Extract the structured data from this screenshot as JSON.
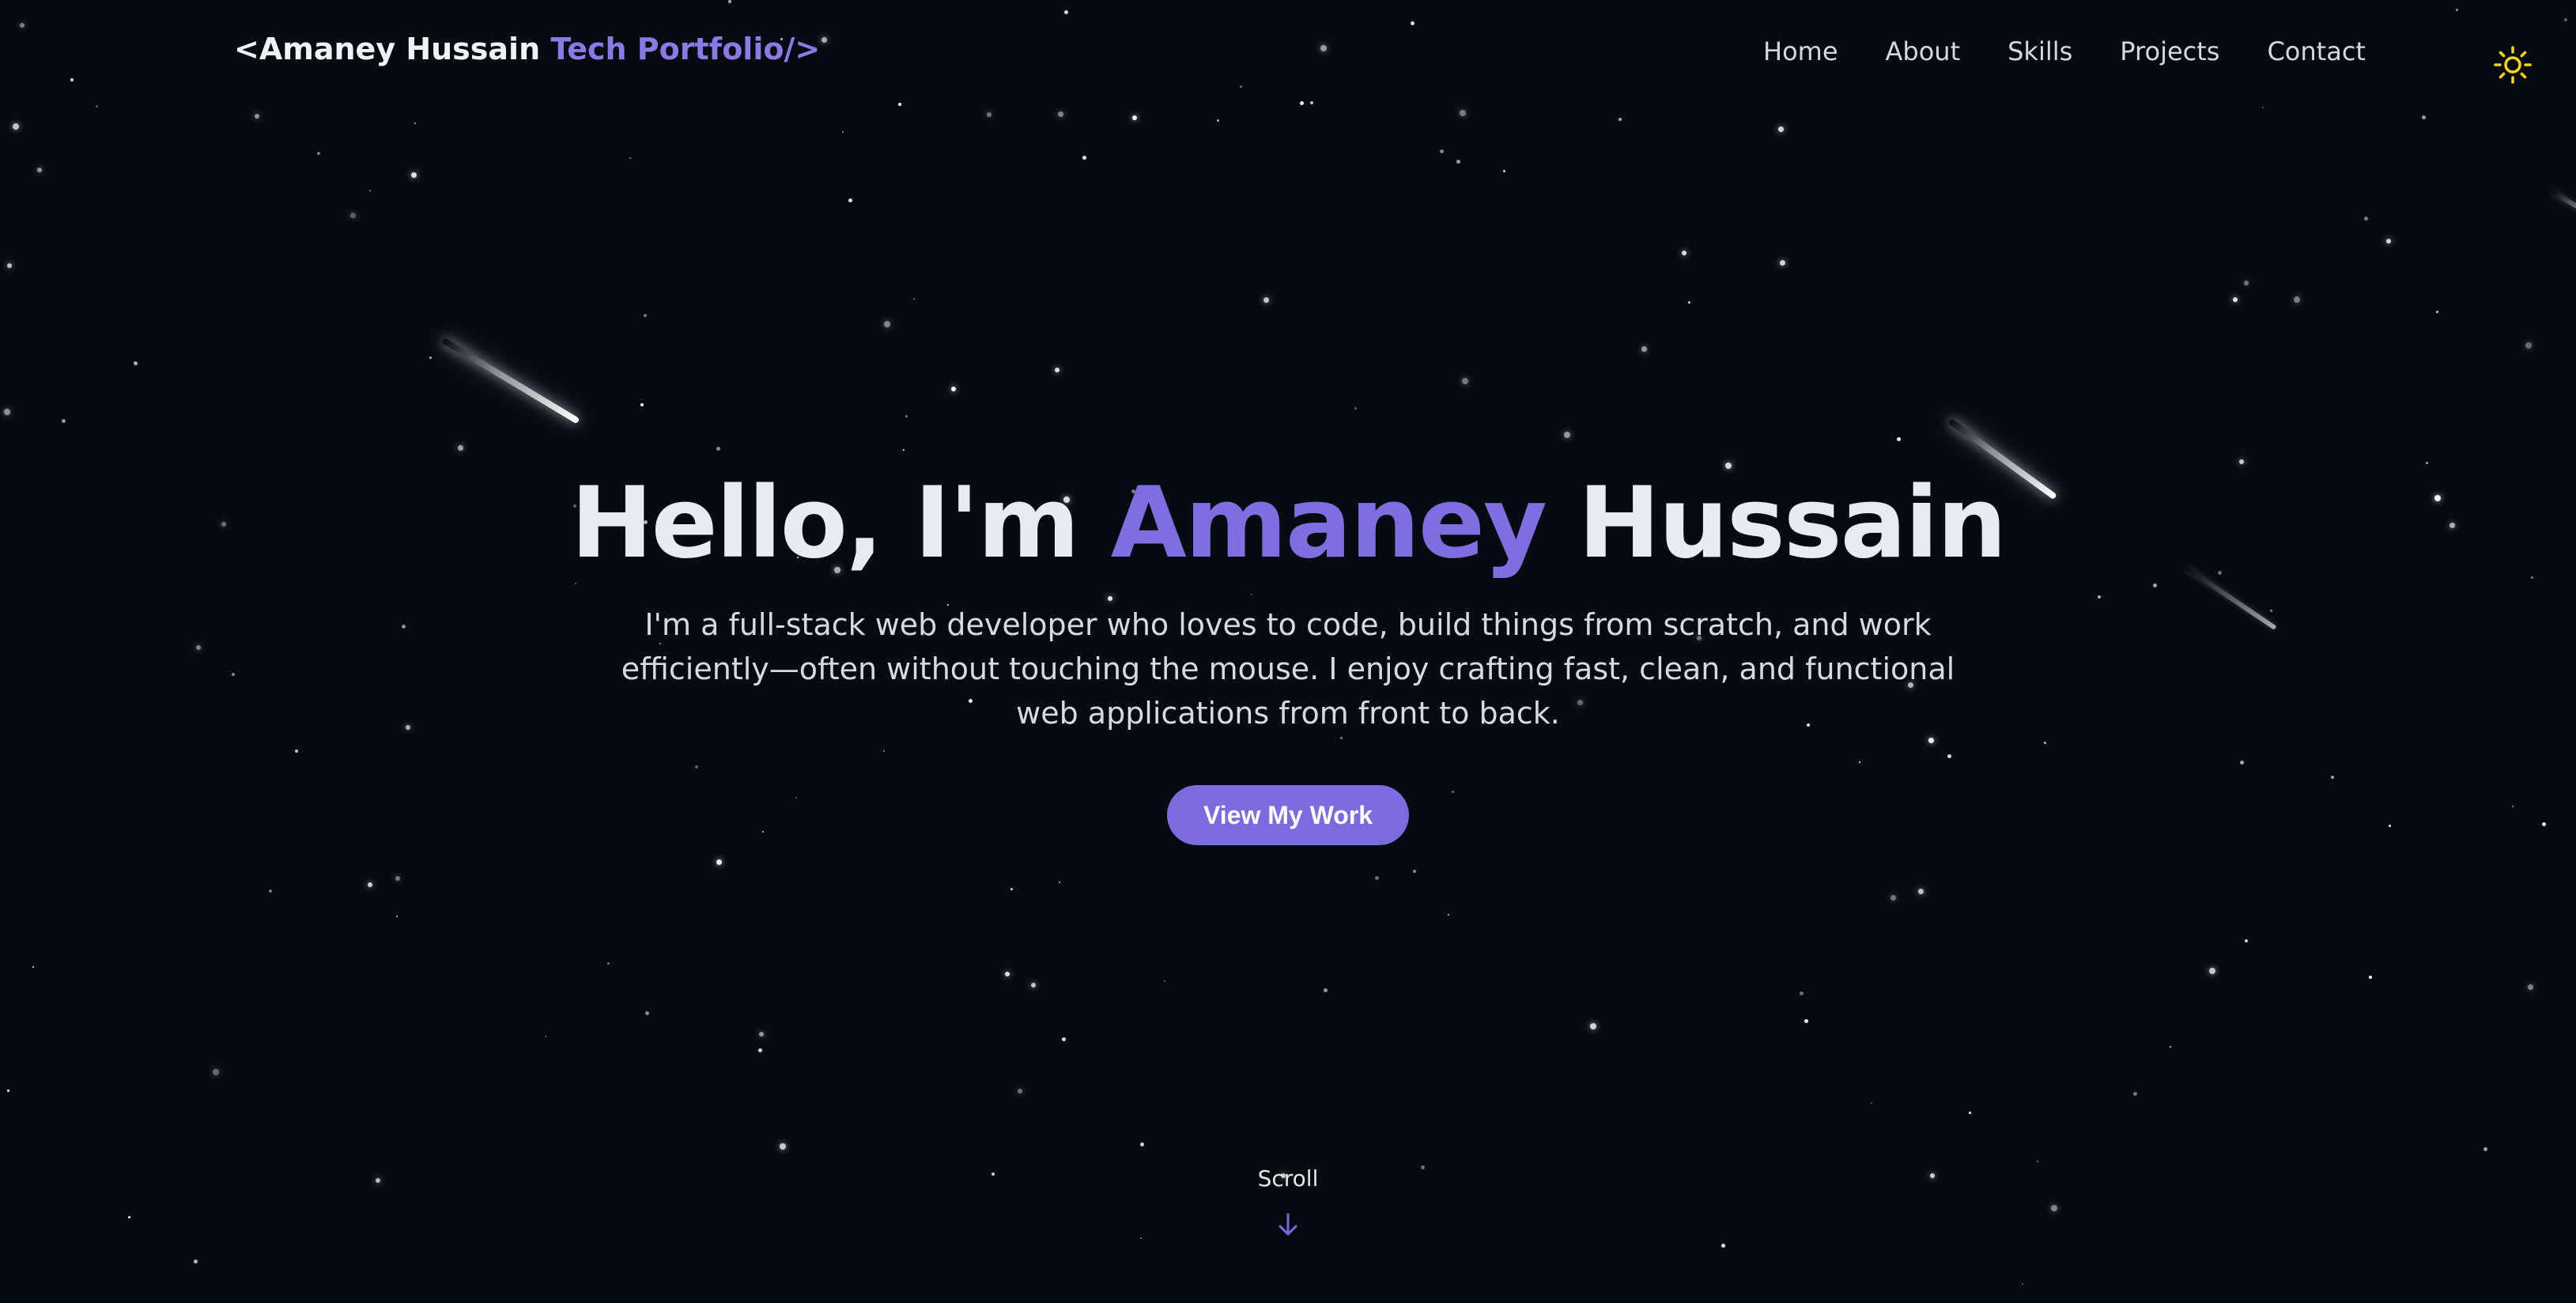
{
  "header": {
    "brand_name": "<Amaney Hussain",
    "brand_accent": " Tech Portfolio/>",
    "nav": [
      {
        "label": "Home"
      },
      {
        "label": "About"
      },
      {
        "label": "Skills"
      },
      {
        "label": "Projects"
      },
      {
        "label": "Contact"
      }
    ],
    "theme_toggle_icon": "sun-icon"
  },
  "hero": {
    "title_prefix": "Hello, I'm ",
    "title_accent": "Amaney",
    "title_suffix": " Hussain",
    "description": "I'm a full-stack web developer who loves to code, build things from scratch, and work efficiently—often without touching the mouse. I enjoy crafting fast, clean, and functional web applications from front to back.",
    "cta_label": "View My Work"
  },
  "scroll": {
    "label": "Scroll",
    "icon": "arrow-down-icon"
  },
  "colors": {
    "background": "#080a12",
    "accent": "#7f6ee0",
    "text": "#e8ebf3",
    "sun": "#f5d90a"
  }
}
